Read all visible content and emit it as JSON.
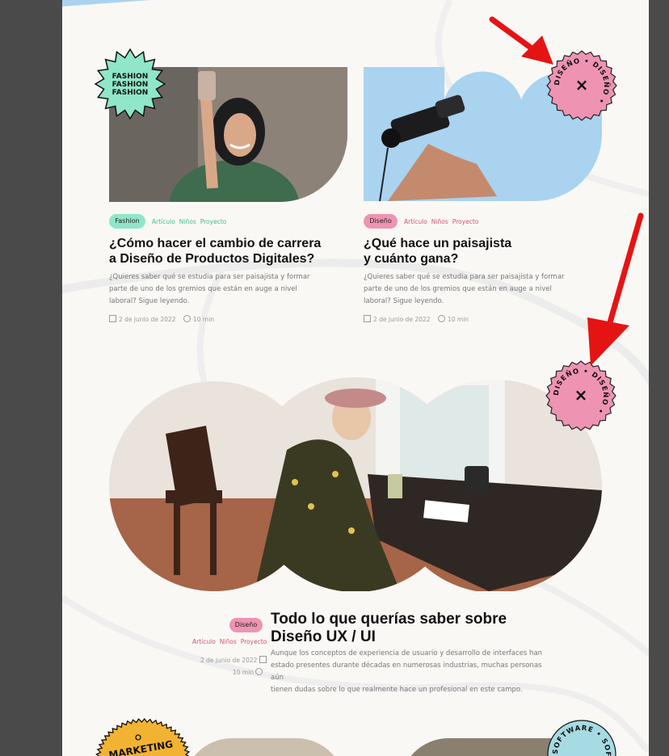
{
  "cards": [
    {
      "badge_text": "FASHION",
      "category": "Fashion",
      "tags": [
        "Artículo",
        "Niños",
        "Proyecto"
      ],
      "title_line1": "¿Cómo hacer el cambio de carrera",
      "title_line2": "a Diseño de Productos Digitales?",
      "desc_line1": "¿Quieres saber qué se estudia para ser paisajista y formar",
      "desc_line2": "parte de uno de los gremios que están en auge a nivel",
      "desc_line3": "laboral? Sigue leyendo.",
      "date": "2 de junio de 2022",
      "read_time": "10 min"
    },
    {
      "badge_text": "DISEÑO • DISEÑO •",
      "category": "Diseño",
      "tags": [
        "Artículo",
        "Niños",
        "Proyecto"
      ],
      "title_line1": "¿Qué hace un paisajista",
      "title_line2": "y cuánto gana?",
      "desc_line1": "¿Quieres saber qué se estudia para ser paisajista y formar",
      "desc_line2": "parte de uno de los gremios que están en auge a nivel",
      "desc_line3": "laboral? Sigue leyendo.",
      "date": "2 de junio de 2022",
      "read_time": "10 min"
    }
  ],
  "featured": {
    "badge_text": "DISEÑO • DISEÑO •",
    "category": "Diseño",
    "tags": [
      "Artículo",
      "Niños",
      "Proyecto"
    ],
    "title_line1": "Todo lo que querías saber sobre",
    "title_line2": "Diseño UX / UI",
    "desc_line1": "Aunque los conceptos de experiencia de usuario y desarrollo de interfaces han",
    "desc_line2": "estado presentes durante décadas en numerosas industrias, muchas personas aún",
    "desc_line3": "tienen dudas sobre lo que realmente hace un profesional en este campo.",
    "date": "2 de junio de 2022",
    "read_time": "10 min"
  },
  "bottom": {
    "badge_left": "MARKETING",
    "badge_right": "SOFTWARE • SOFTWARE •"
  },
  "colors": {
    "fashion": "#8fe6c8",
    "diseno": "#ef93b3",
    "tag_green": "#3cbf8c",
    "tag_pink": "#d0507c",
    "sky": "#a9d3ef",
    "marketing": "#f3b332",
    "software": "#a6dbe3",
    "arrow": "#e51414"
  }
}
